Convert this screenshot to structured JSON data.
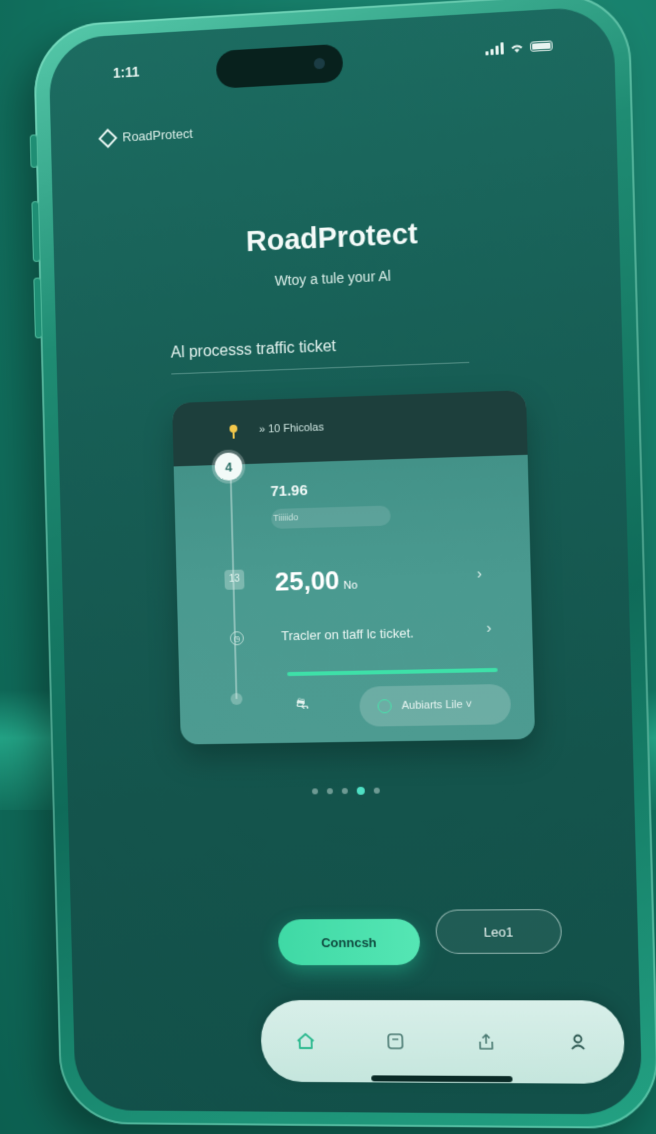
{
  "status_bar": {
    "time": "1:11"
  },
  "app": {
    "brand": "RoadProtect"
  },
  "hero": {
    "title": "RoadProtect",
    "subtitle": "Wtoy a tule your Al"
  },
  "section": {
    "label": "Al processs traffic ticket"
  },
  "card": {
    "header_text": "» 10 Fhicolas",
    "top_node_label": "4",
    "value_small": "71.96",
    "value_small_sub": "Tiiiiido",
    "square_label": "13",
    "big_value": "25,00",
    "big_unit": "No",
    "row_text": "Tracler on tlaff lc ticket.",
    "pill_text": "Aubiarts Lile ˅",
    "progress": 0.7
  },
  "pagination": {
    "total": 5,
    "active_index": 3
  },
  "actions": {
    "primary_label": "Conncsh",
    "secondary_label": "Leo1"
  },
  "tab_bar": {
    "items": [
      {
        "icon": "home-icon",
        "active": true
      },
      {
        "icon": "ticket-icon",
        "active": false
      },
      {
        "icon": "share-icon",
        "active": false
      },
      {
        "icon": "profile-icon",
        "active": false
      }
    ]
  },
  "colors": {
    "accent": "#3fd9a5",
    "screen_bg": "#175e55",
    "card_bg": "#4a9a90"
  }
}
